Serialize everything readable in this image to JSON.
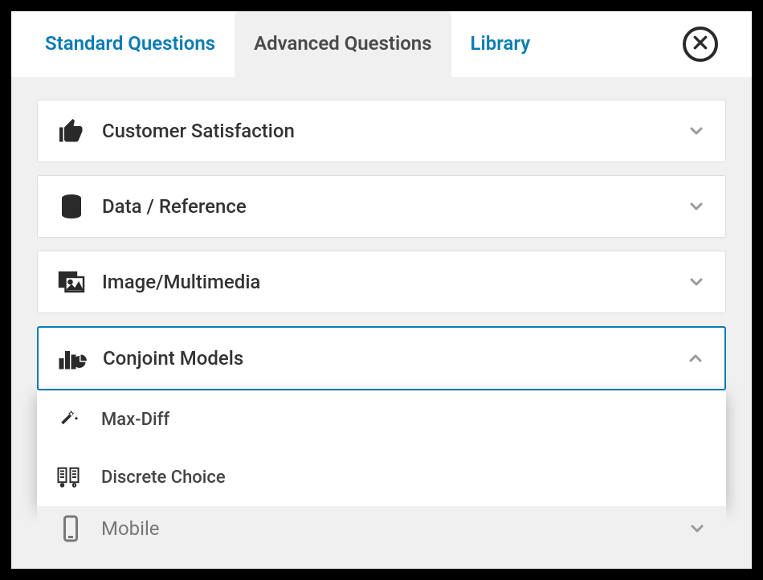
{
  "tabs": {
    "standard": "Standard Questions",
    "advanced": "Advanced Questions",
    "library": "Library"
  },
  "categories": {
    "customer_satisfaction": "Customer Satisfaction",
    "data_reference": "Data / Reference",
    "image_multimedia": "Image/Multimedia",
    "conjoint_models": "Conjoint Models",
    "mobile": "Mobile"
  },
  "conjoint_sub": {
    "maxdiff": "Max-Diff",
    "discrete": "Discrete Choice"
  }
}
